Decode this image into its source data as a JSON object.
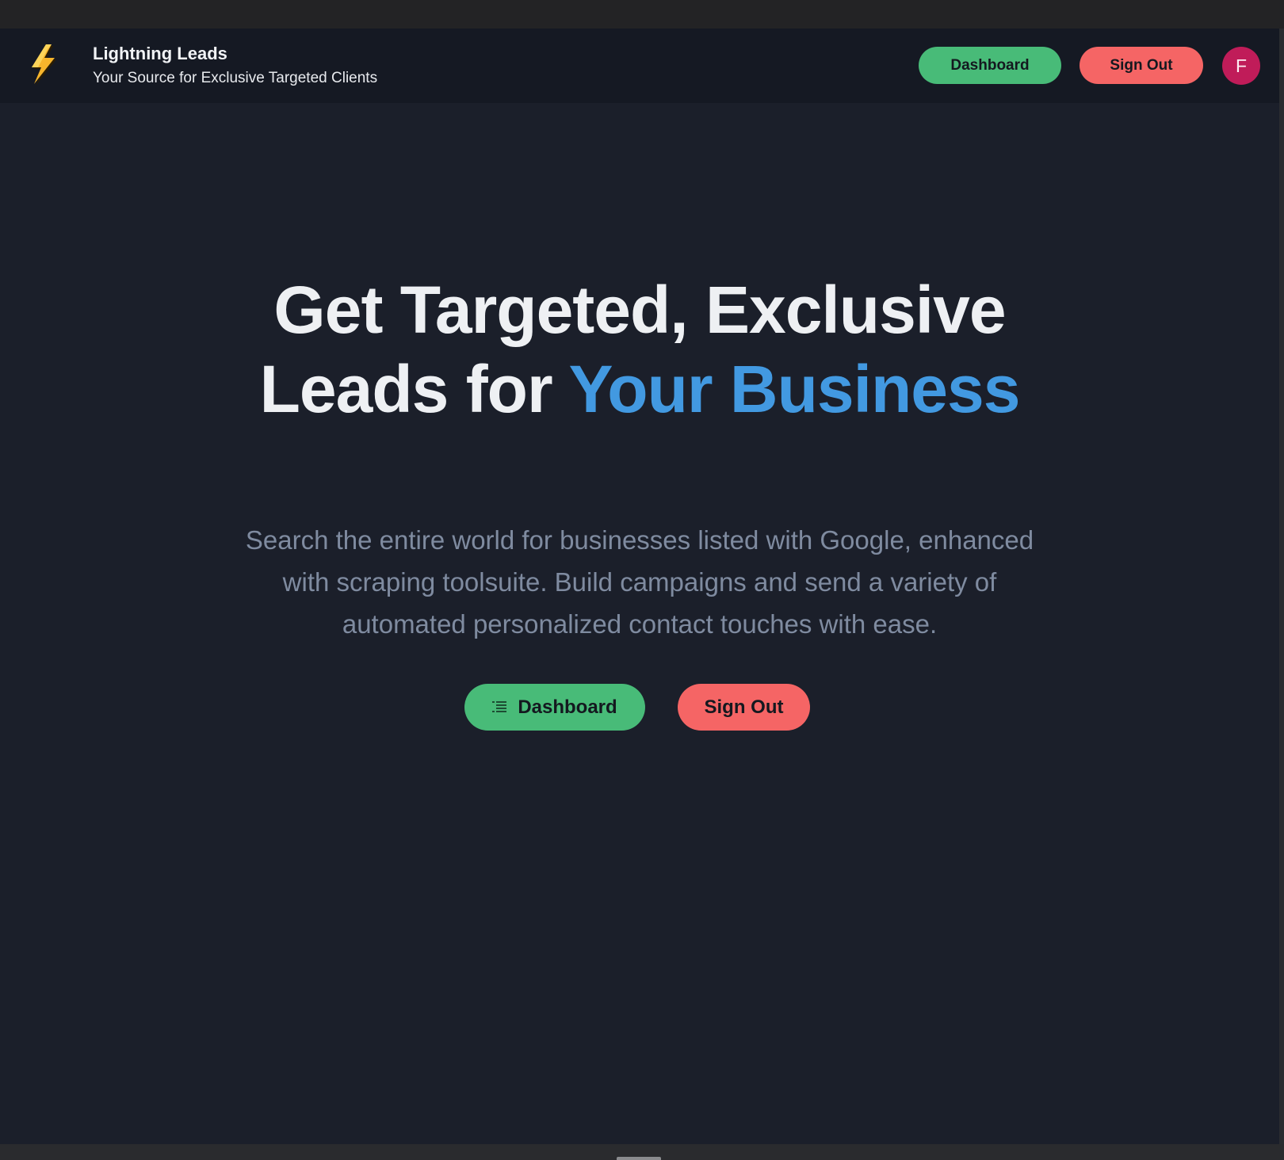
{
  "header": {
    "brand_title": "Lightning Leads",
    "brand_subtitle": "Your Source for Exclusive Targeted Clients",
    "dashboard_label": "Dashboard",
    "signout_label": "Sign Out",
    "avatar_initial": "F",
    "logo_icon": "lightning-bolt-icon"
  },
  "hero": {
    "title_line1": "Get Targeted, Exclusive",
    "title_line2_plain": "Leads for ",
    "title_line2_accent": "Your Business",
    "description": "Search the entire world for businesses listed with Google, enhanced with scraping toolsuite. Build campaigns and send a variety of automated personalized contact touches with ease.",
    "dashboard_label": "Dashboard",
    "dashboard_icon": "list-icon",
    "signout_label": "Sign Out"
  },
  "colors": {
    "background": "#1b1f2a",
    "header_background": "#151923",
    "accent_blue": "#4299e1",
    "green_button": "#48bb78",
    "red_button": "#f56565",
    "avatar": "#c01c59",
    "description_text": "#7f8ba0"
  }
}
